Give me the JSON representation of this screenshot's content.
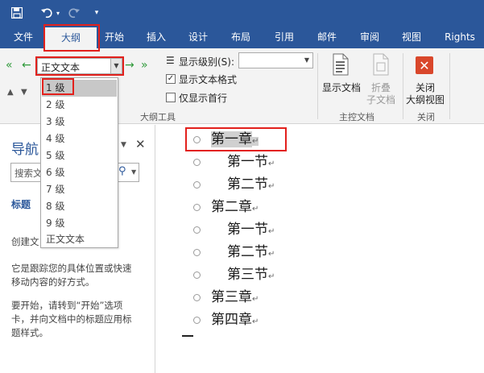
{
  "tabs": [
    {
      "label": "文件"
    },
    {
      "label": "大纲"
    },
    {
      "label": "开始"
    },
    {
      "label": "插入"
    },
    {
      "label": "设计"
    },
    {
      "label": "布局"
    },
    {
      "label": "引用"
    },
    {
      "label": "邮件"
    },
    {
      "label": "审阅"
    },
    {
      "label": "视图"
    },
    {
      "label": "Rights"
    }
  ],
  "ribbon": {
    "level_combo_value": "正文文本",
    "show_level_label": "显示级别(S):",
    "show_level_value": "",
    "show_text_format_label": "显示文本格式",
    "show_text_format_checked": true,
    "first_line_only_label": "仅显示首行",
    "first_line_only_checked": false,
    "outline_tools_label": "大纲工具",
    "show_document_label": "显示文档",
    "collapse_line1": "折叠",
    "collapse_line2": "子文档",
    "master_document_label": "主控文档",
    "close_line1": "关闭",
    "close_line2": "大纲视图",
    "close_group_label": "关闭"
  },
  "dropdown": {
    "items": [
      "1 级",
      "2 级",
      "3 级",
      "4 级",
      "5 级",
      "6 级",
      "7 级",
      "8 级",
      "9 级",
      "正文文本"
    ],
    "selected_index": 0
  },
  "nav": {
    "title": "导航",
    "search_placeholder": "搜索文",
    "headings_tab": "标题",
    "create_text": "创建文",
    "info_line1": "它是跟踪您的具体位置或快速",
    "info_line2": "移动内容的好方式。",
    "start_line1": "要开始，请转到“开始”选项",
    "start_line2": "卡，并向文档中的标题应用标",
    "start_line3": "题样式。"
  },
  "outline": [
    {
      "text": "第一章",
      "level": 1
    },
    {
      "text": "第一节",
      "level": 2
    },
    {
      "text": "第二节",
      "level": 2
    },
    {
      "text": "第二章",
      "level": 1
    },
    {
      "text": "第一节",
      "level": 2
    },
    {
      "text": "第二节",
      "level": 2
    },
    {
      "text": "第三节",
      "level": 2
    },
    {
      "text": "第三章",
      "level": 1
    },
    {
      "text": "第四章",
      "level": 1
    }
  ],
  "colors": {
    "title_bar": "#2b579a",
    "highlight_box": "#e2201c",
    "close_button": "#d9472b"
  }
}
